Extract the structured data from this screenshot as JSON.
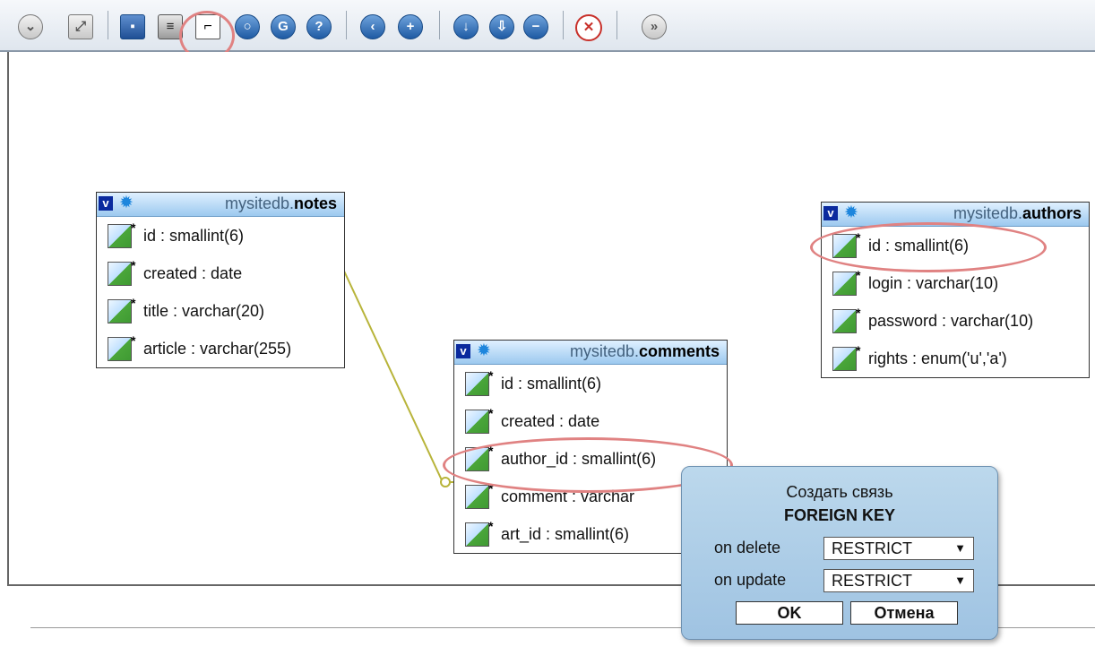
{
  "toolbar": {
    "icons": [
      "collapse-all-icon",
      "fullscreen-icon",
      "save-icon",
      "list-icon",
      "relation-icon",
      "circle-o-icon",
      "refresh-icon",
      "help-icon",
      "circle-left-icon",
      "circle-plus-icon",
      "circle-down-icon",
      "circle-download-icon",
      "circle-minus-icon",
      "pdf-icon",
      "forward-icon"
    ]
  },
  "tables": {
    "notes": {
      "db": "mysitedb.",
      "name": "notes",
      "fields": [
        "id : smallint(6)",
        "created : date",
        "title : varchar(20)",
        "article : varchar(255)"
      ]
    },
    "comments": {
      "db": "mysitedb.",
      "name": "comments",
      "fields": [
        "id : smallint(6)",
        "created : date",
        "author_id : smallint(6)",
        "comment : varchar",
        "art_id : smallint(6)"
      ]
    },
    "authors": {
      "db": "mysitedb.",
      "name": "authors",
      "fields": [
        "id : smallint(6)",
        "login : varchar(10)",
        "password : varchar(10)",
        "rights : enum('u','a')"
      ]
    }
  },
  "popup": {
    "title1": "Создать связь",
    "title2": "FOREIGN KEY",
    "on_delete_label": "on delete",
    "on_delete_value": "RESTRICT",
    "on_update_label": "on update",
    "on_update_value": "RESTRICT",
    "ok": "OK",
    "cancel": "Отмена"
  },
  "colors": {
    "header_gradient_top": "#dff0ff",
    "header_gradient_bottom": "#9cc9ef",
    "highlight": "#e08282",
    "connector": "#b8b43a",
    "popup_bg": "#b5d3ea"
  }
}
